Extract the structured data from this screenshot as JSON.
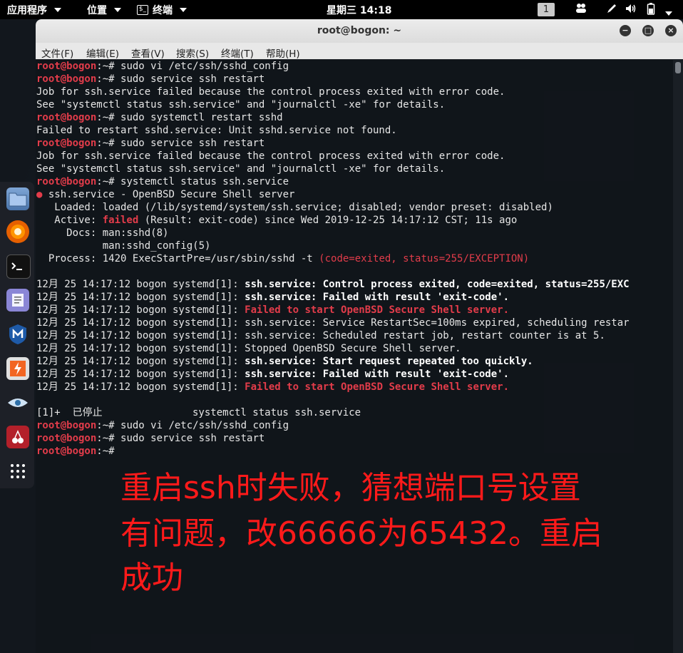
{
  "topbar": {
    "applications": "应用程序",
    "places": "位置",
    "terminal_app": "终端",
    "terminal_glyph": "$_",
    "clock": "星期三 14:18",
    "workspace": "1",
    "tray_icons": [
      "people-icon",
      "pen-icon",
      "volume-icon",
      "battery-icon",
      "chevron-down-icon"
    ]
  },
  "dock": {
    "items": [
      "files",
      "firefox",
      "terminal",
      "text-editor",
      "metasploit",
      "burpsuite",
      "eye-app",
      "cherrytree",
      "show-apps"
    ]
  },
  "window": {
    "title": "root@bogon: ~",
    "minimize": "−",
    "maximize": "□",
    "close": "×"
  },
  "menubar": {
    "file": "文件(F)",
    "edit": "编辑(E)",
    "view": "查看(V)",
    "search": "搜索(S)",
    "terminal": "终端(T)",
    "help": "帮助(H)"
  },
  "terminal": {
    "prompt_user": "root@bogon",
    "prompt_suffix": ":~# ",
    "prompt_plain": ":~#",
    "commands": {
      "c1": "sudo vi /etc/ssh/sshd_config",
      "c2": "sudo service ssh restart",
      "c3": "sudo systemctl restart sshd",
      "c4": "sudo service ssh restart",
      "c5": "systemctl status ssh.service",
      "c6": "sudo vi /etc/ssh/sshd_config",
      "c7": "sudo service ssh restart"
    },
    "out": {
      "job1": "Job for ssh.service failed because the control process exited with error code.",
      "see1": "See \"systemctl status ssh.service\" and \"journalctl -xe\" for details.",
      "failed_sshd": "Failed to restart sshd.service: Unit sshd.service not found.",
      "job2": "Job for ssh.service failed because the control process exited with error code.",
      "see2": "See \"systemctl status ssh.service\" and \"journalctl -xe\" for details.",
      "dot": "●",
      "svc": " ssh.service - OpenBSD Secure Shell server",
      "loaded": "   Loaded: loaded (/lib/systemd/system/ssh.service; disabled; vendor preset: disabled)",
      "active_pre": "   Active: ",
      "active_failed": "failed",
      "active_post": " (Result: exit-code) since Wed 2019-12-25 14:17:12 CST; 11s ago",
      "docs": "     Docs: man:sshd(8)",
      "docs2": "           man:sshd_config(5)",
      "process_pre": "  Process: 1420 ExecStartPre=/usr/sbin/sshd -t ",
      "process_red": "(code=exited, status=255/EXCEPTION)",
      "jobs": "[1]+  已停止               systemctl status ssh.service"
    },
    "log_prefix": "12月 25 14:17:12 bogon systemd[1]: ",
    "log": {
      "l1": "ssh.service: Control process exited, code=exited, status=255/EXC",
      "l2": "ssh.service: Failed with result 'exit-code'.",
      "l3": "Failed to start OpenBSD Secure Shell server.",
      "l4": "ssh.service: Service RestartSec=100ms expired, scheduling restar",
      "l5": "ssh.service: Scheduled restart job, restart counter is at 5.",
      "l6": "Stopped OpenBSD Secure Shell server.",
      "l7": "ssh.service: Start request repeated too quickly.",
      "l8": "ssh.service: Failed with result 'exit-code'.",
      "l9": "Failed to start OpenBSD Secure Shell server."
    }
  },
  "annotation": {
    "line1": "重启ssh时失败，猜想端口号设置",
    "line2": "有问题，改66666为65432。重启",
    "line3": "成功"
  }
}
